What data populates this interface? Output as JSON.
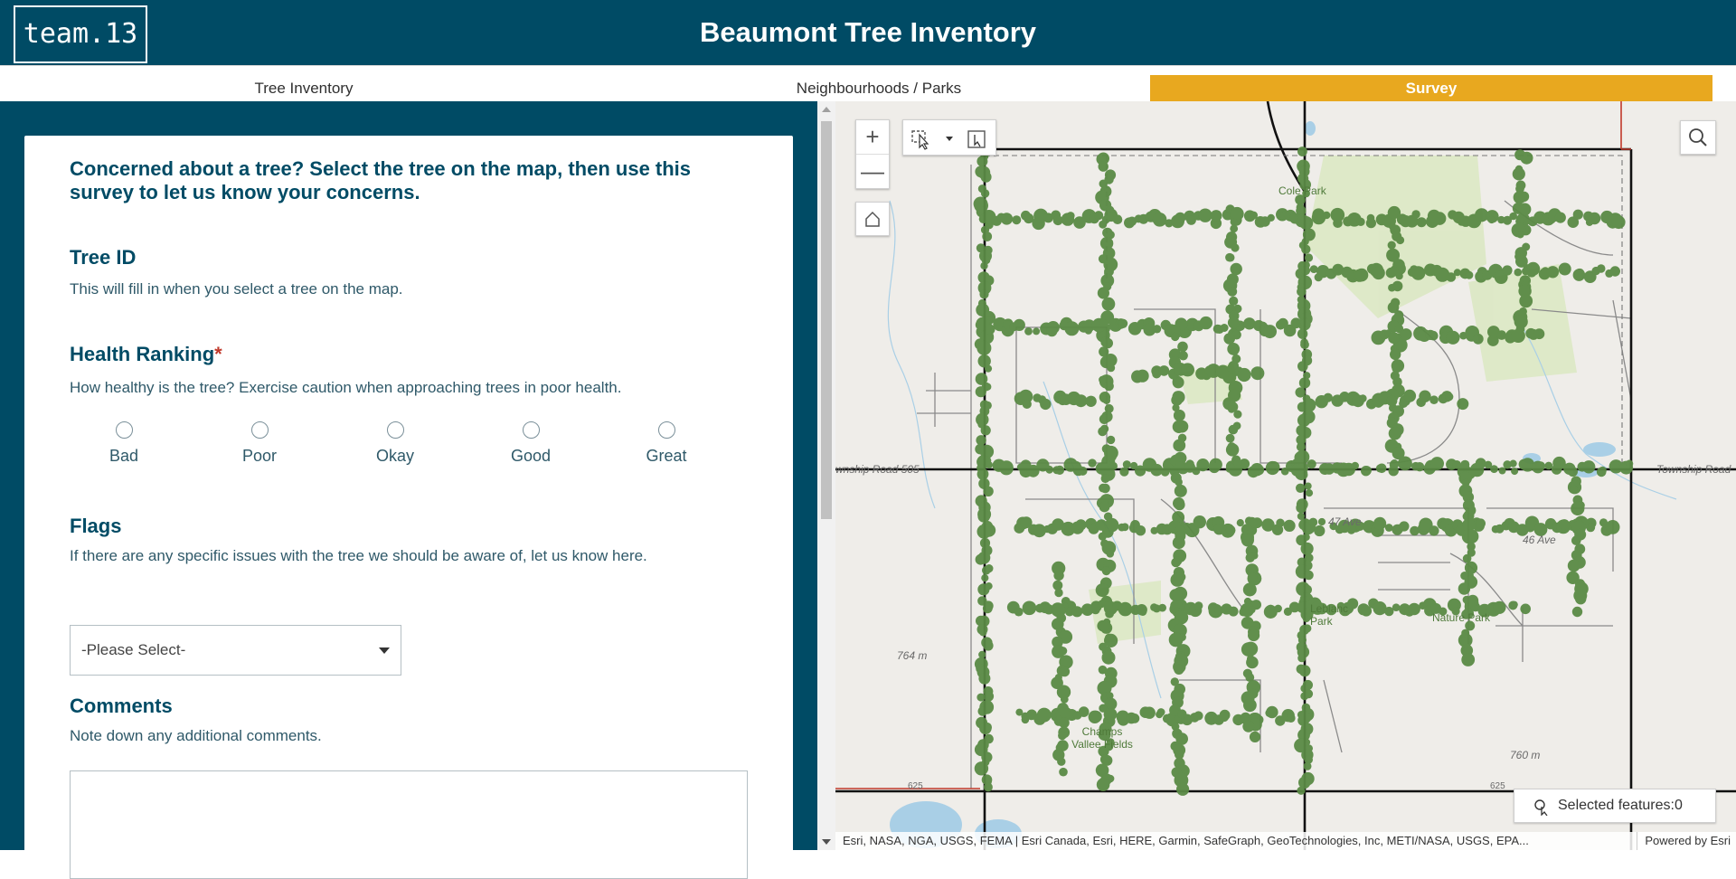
{
  "header": {
    "logo": "team.13",
    "title": "Beaumont Tree Inventory"
  },
  "tabs": [
    {
      "label": "Tree Inventory",
      "active": false
    },
    {
      "label": "Neighbourhoods / Parks",
      "active": false
    },
    {
      "label": "Survey",
      "active": true
    }
  ],
  "survey": {
    "intro": "Concerned about a tree? Select the tree on the map, then use this survey to let us know your concerns.",
    "tree_id": {
      "title": "Tree ID",
      "desc": "This will fill in when you select a tree on the map."
    },
    "health": {
      "title": "Health Ranking",
      "required_mark": "*",
      "desc": "How healthy is the tree? Exercise caution when approaching trees in poor health.",
      "options": [
        "Bad",
        "Poor",
        "Okay",
        "Good",
        "Great"
      ]
    },
    "flags": {
      "title": "Flags",
      "desc": "If there are any specific issues with the tree we should be aware of, let us know here.",
      "select_value": "-Please Select-"
    },
    "comments": {
      "title": "Comments",
      "desc": "Note down any additional comments.",
      "value": ""
    }
  },
  "map": {
    "zoom_in": "+",
    "zoom_out": "—",
    "selected_features": "Selected features:0",
    "attribution": "Esri, NASA, NGA, USGS, FEMA | Esri Canada, Esri, HERE, Garmin, SafeGraph, GeoTechnologies, Inc, METI/NASA, USGS, EPA...",
    "powered_by": "Powered by Esri",
    "labels": {
      "township_road_left": "wnship Road 505",
      "township_road_right": "Township Road",
      "elev_764": "764 m",
      "elev_760": "760 m",
      "ave_46": "46 Ave",
      "ave_47": "47 Ave",
      "park_cole": "Cole Park",
      "park_champs": "Champs Vallee Fields",
      "park_leblanc": "Leblanc Park",
      "park_nature": "Nature Park",
      "hwy_625_left": "625",
      "hwy_625_right": "625"
    },
    "colors": {
      "tree": "#5a8a45",
      "road_major": "#111111",
      "road_minor": "#8a8a8a",
      "water": "#a9cfe6",
      "park": "#dce8c4"
    }
  }
}
